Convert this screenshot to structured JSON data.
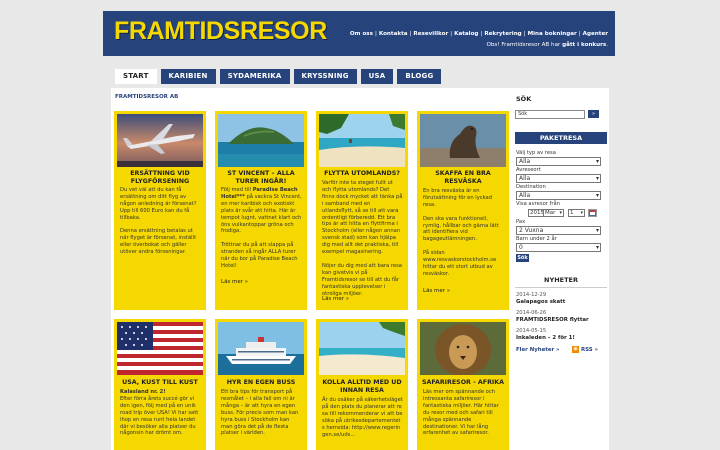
{
  "header": {
    "logo": "FRAMTIDSRESOR",
    "nav": [
      "Om oss",
      "Kontakta",
      "Resevillkor",
      "Katalog",
      "Rekrytering",
      "Mina bokningar",
      "Agenter"
    ],
    "notice_pre": "Obs! Framtidsresor AB har ",
    "notice_bold": "gått i konkurs",
    "notice_post": "."
  },
  "tabs": [
    "START",
    "KARIBIEN",
    "SYDAMERIKA",
    "KRYSSNING",
    "USA",
    "BLOGG"
  ],
  "breadcrumb": "FRAMTIDSRESOR AB",
  "cards": [
    {
      "title": "ERSÄTTNING VID FLYGFÖRSENING",
      "image": "airplane-photo",
      "text": "Du vet väl att du kan få ersättning om ditt flyg av någon anledning är försenat? Upp till 600 Euro kan du få tillbaka.\n\nDenna ersättning betalas ut när flyget är försenat, inställt eller överbokat och gäller utöver andra förseningar.",
      "more": ""
    },
    {
      "title": "ST VINCENT – ALLA TURER INGÅR!",
      "image": "island-photo",
      "text_pre": "Följ med till ",
      "text_bold": "Paradise Beach Hotel***",
      "text_post": " på vackra St Vincent, en mer karibisk och exotiskt plats är svår att hitta. Här är tempot lugnt, vattnet klart och öns vulkantoppar gröna och frodiga.\n\nTröttnar du på att slappa på stranden så ingår ALLA turer när du bor på Paradise Beach Hotel!",
      "more": "Läs mer »"
    },
    {
      "title": "FLYTTA UTOMLANDS?",
      "image": "beach-photo",
      "text": "Varför inte ta steget fullt ut och flytta utomlands? Det finns dock mycket att tänka på i samband med en utlandsflytt, så se till att vara ordentligt förberedd. Ett bra tips är att hitta en flyttfirma i Stockholm (eller någon annan svensk stad) som kan hjälpa dig med allt det praktiska, till exempel magasinering.\n\nNöjer du dig med att bara resa kan givetvis vi på Framtidsresor se till att du får fantastiska upplevelser i otroliga miljöer.",
      "more": "Läs mer »"
    },
    {
      "title": "SKAFFA EN BRA RESVÄSKA",
      "image": "sealion-photo",
      "text": "En bra resväska är en förutsättning för en lyckad resa.\n\nDen ska vara funktionell, rymlig, hållbar och gärna lätt att identifiera vid bagageutlämningen.\n\nPå sidan www.resvaskorstockholm.se hittar du ett stort utbud av resväskor.",
      "more": "Läs mer »"
    },
    {
      "title": "USA, KUST TILL KUST",
      "image": "usa-flag-photo",
      "text_bold": "Kalasland nr. 2!",
      "text_post": "\nEfter förra årets succé gör vi den igen, följ med på en unik road trip över USA! Vi har satt ihop en resa runt hela landet där vi besöker alla platser du någonsin har drömt om.",
      "more": ""
    },
    {
      "title": "HYR EN EGEN BUSS",
      "image": "cruise-ship-photo",
      "text": "Ett bra tips för transport på resmålet – i alla fall om ni är många – är att hyra en egen buss. För precis som man kan hyra buss i Stockholm kan man göra det på de flesta platser i världen.",
      "more": ""
    },
    {
      "title": "KOLLA ALLTID MED UD INNAN RESA",
      "image": "beach-palm-photo",
      "text": "Är du osäker på säkerhetsläget på den plats du planerar att resa till rekommenderar vi att besöka på utrikesdepartementets hemsida: http://www.regeringen.se/uds...",
      "more": ""
    },
    {
      "title": "SAFARIRESOR - AFRIKA",
      "image": "lion-photo",
      "text": "Läs mer om spännande och intressanta safariresor i fantastiska miljöer. Här hittar du resor med och safari till många spännande destinationer. Vi har lång erfarenhet av safariresor.",
      "more": ""
    }
  ],
  "sidebar": {
    "search_title": "SÖK",
    "search_value": "Sök",
    "search_button": "»",
    "paketresa_title": "PAKETRESA",
    "fields": [
      {
        "label": "Välj typ av resa",
        "value": "Alla"
      },
      {
        "label": "Avreseort",
        "value": "Alla"
      },
      {
        "label": "Destination",
        "value": "Alla"
      }
    ],
    "date_label": "Visa avresor från",
    "date_year": "2015",
    "date_month": "Mar",
    "date_day": "1",
    "pax_label": "Pax",
    "pax_value": "2 Vuxna",
    "children_label": "Barn under 2 år",
    "children_value": "0",
    "submit": "Sök",
    "news_title": "NYHETER",
    "news": [
      {
        "date": "2014-12-29",
        "text": "Galapagos skatt"
      },
      {
        "date": "2014-06-26",
        "text": "FRAMTIDSRESOR flyttar"
      },
      {
        "date": "2014-05-15",
        "text": "Inkaleden – 2 för 1!"
      }
    ],
    "more_news": "Fler Nyheter »",
    "rss": "RSS »"
  },
  "colors": {
    "brand": "#27437c",
    "accent": "#f5d800"
  }
}
